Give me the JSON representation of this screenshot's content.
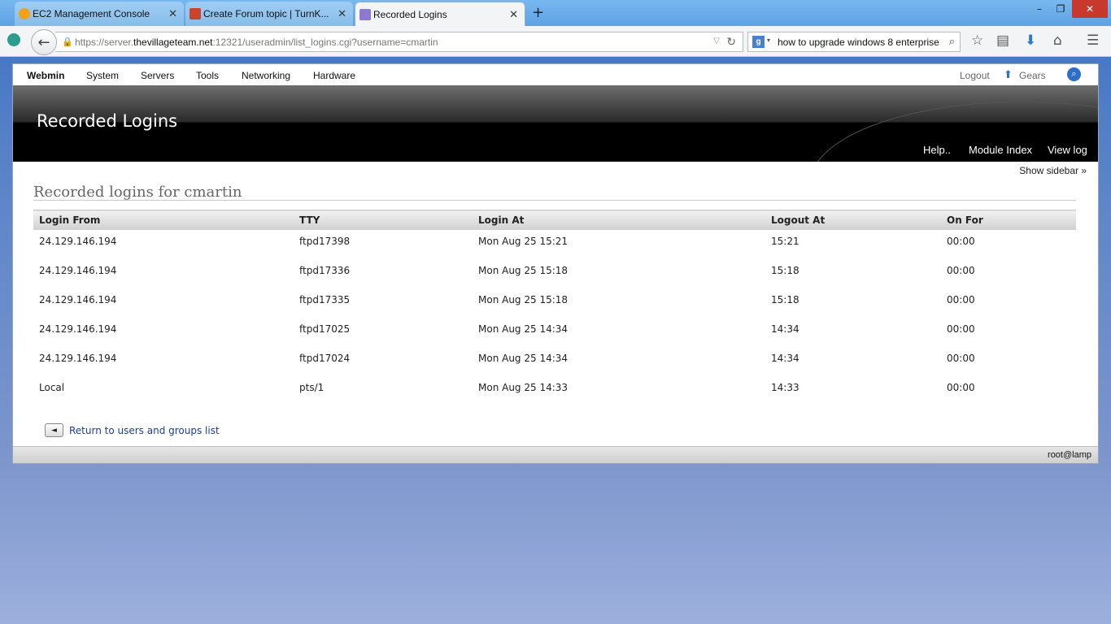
{
  "browser": {
    "tabs": [
      {
        "title": "EC2 Management Console",
        "active": false
      },
      {
        "title": "Create Forum topic | TurnK...",
        "active": false
      },
      {
        "title": "Recorded Logins",
        "active": true
      }
    ],
    "new_tab": "+",
    "url_prefix": "https://server.",
    "url_domain": "thevillageteam.net",
    "url_suffix": ":12321/useradmin/list_logins.cgi?username=cmartin",
    "search_value": "how to upgrade windows 8 enterprise",
    "window_controls": [
      "–",
      "❐",
      "✕"
    ]
  },
  "webmin": {
    "topnav": [
      "Webmin",
      "System",
      "Servers",
      "Tools",
      "Networking",
      "Hardware"
    ],
    "logout": "Logout",
    "gears": "Gears",
    "title": "Recorded Logins",
    "header_links": [
      "Help..",
      "Module Index",
      "View log"
    ],
    "show_sidebar": "Show sidebar »",
    "section_title": "Recorded logins for cmartin",
    "columns": [
      "Login From",
      "TTY",
      "Login At",
      "Logout At",
      "On For"
    ],
    "rows": [
      [
        "24.129.146.194",
        "ftpd17398",
        "Mon Aug 25 15:21",
        "15:21",
        "00:00"
      ],
      [
        "24.129.146.194",
        "ftpd17336",
        "Mon Aug 25 15:18",
        "15:18",
        "00:00"
      ],
      [
        "24.129.146.194",
        "ftpd17335",
        "Mon Aug 25 15:18",
        "15:18",
        "00:00"
      ],
      [
        "24.129.146.194",
        "ftpd17025",
        "Mon Aug 25 14:34",
        "14:34",
        "00:00"
      ],
      [
        "24.129.146.194",
        "ftpd17024",
        "Mon Aug 25 14:34",
        "14:34",
        "00:00"
      ],
      [
        "Local",
        "pts/1",
        "Mon Aug 25 14:33",
        "14:33",
        "00:00"
      ]
    ],
    "return_link": "Return to users and groups list",
    "return_icon": "◄",
    "footer_user": "root@lamp"
  }
}
